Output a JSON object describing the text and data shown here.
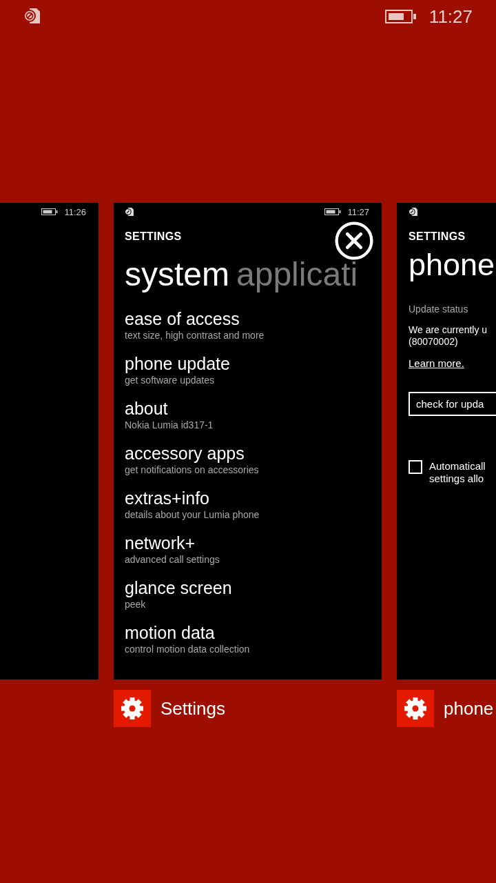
{
  "status_bar": {
    "time": "11:27"
  },
  "cards": [
    {
      "kind": "blank",
      "time": "11:26"
    },
    {
      "kind": "list",
      "close_button": true,
      "time": "11:27",
      "header": "SETTINGS",
      "title": "system",
      "title_next": "applicati",
      "app_label": "Settings",
      "items": [
        {
          "title": "ease of access",
          "subtitle": "text size, high contrast and more"
        },
        {
          "title": "phone update",
          "subtitle": "get software updates"
        },
        {
          "title": "about",
          "subtitle": "Nokia Lumia id317-1"
        },
        {
          "title": "accessory apps",
          "subtitle": "get notifications on accessories"
        },
        {
          "title": "extras+info",
          "subtitle": "details about your Lumia phone"
        },
        {
          "title": "network+",
          "subtitle": "advanced call settings"
        },
        {
          "title": "glance screen",
          "subtitle": "peek"
        },
        {
          "title": "motion data",
          "subtitle": "control motion data collection"
        }
      ]
    },
    {
      "kind": "detail",
      "header": "SETTINGS",
      "title": "phone",
      "section_label": "Update status",
      "message_lines": [
        "We are currently u",
        "(80070002)"
      ],
      "link": "Learn more.",
      "button": "check for upda",
      "checkbox": {
        "checked": false,
        "lines": [
          "Automaticall",
          "settings allo"
        ]
      },
      "app_label": "phone"
    }
  ]
}
